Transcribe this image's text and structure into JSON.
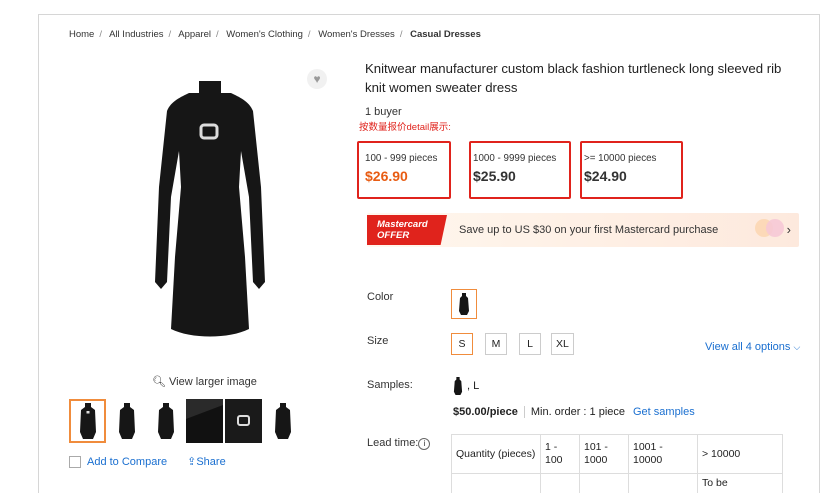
{
  "breadcrumb": [
    "Home",
    "All Industries",
    "Apparel",
    "Women's Clothing",
    "Women's Dresses",
    "Casual Dresses"
  ],
  "product": {
    "title": "Knitwear manufacturer custom black fashion turtleneck long sleeved rib knit women sweater dress",
    "buyers": "1 buyer",
    "annotation": "按数量报价detail展示:"
  },
  "tiers": [
    {
      "qty": "100 - 999 pieces",
      "price": "$26.90",
      "highlight": true
    },
    {
      "qty": "1000 - 9999 pieces",
      "price": "$25.90",
      "highlight": false
    },
    {
      "qty": ">= 10000 pieces",
      "price": "$24.90",
      "highlight": false
    }
  ],
  "promo": {
    "badge_line1": "Mastercard",
    "badge_line2": "OFFER",
    "text": "Save up to US $30 on your first Mastercard purchase",
    "arrow": "›"
  },
  "gallery": {
    "view_larger": "View larger image",
    "add_to_compare": "Add to Compare",
    "share": "Share"
  },
  "options": {
    "color_label": "Color",
    "size_label": "Size",
    "sizes": [
      "S",
      "M",
      "L",
      "XL"
    ],
    "selected_size": "S",
    "view_all": "View all 4 options",
    "samples_label": "Samples:",
    "sample_size": ", L",
    "sample_price": "$50.00/piece",
    "min_order": "Min. order : 1 piece",
    "get_samples": "Get samples",
    "lead_label": "Lead time:"
  },
  "lead_table": {
    "header": [
      "Quantity (pieces)",
      "1 - 100",
      "101 - 1000",
      "1001 - 10000",
      "> 10000"
    ],
    "row2_last": "To be"
  },
  "colors": {
    "accent": "#e85c13",
    "link": "#1a6fd0",
    "annotation_red": "#e0231c",
    "selected_border": "#f08c3c"
  }
}
